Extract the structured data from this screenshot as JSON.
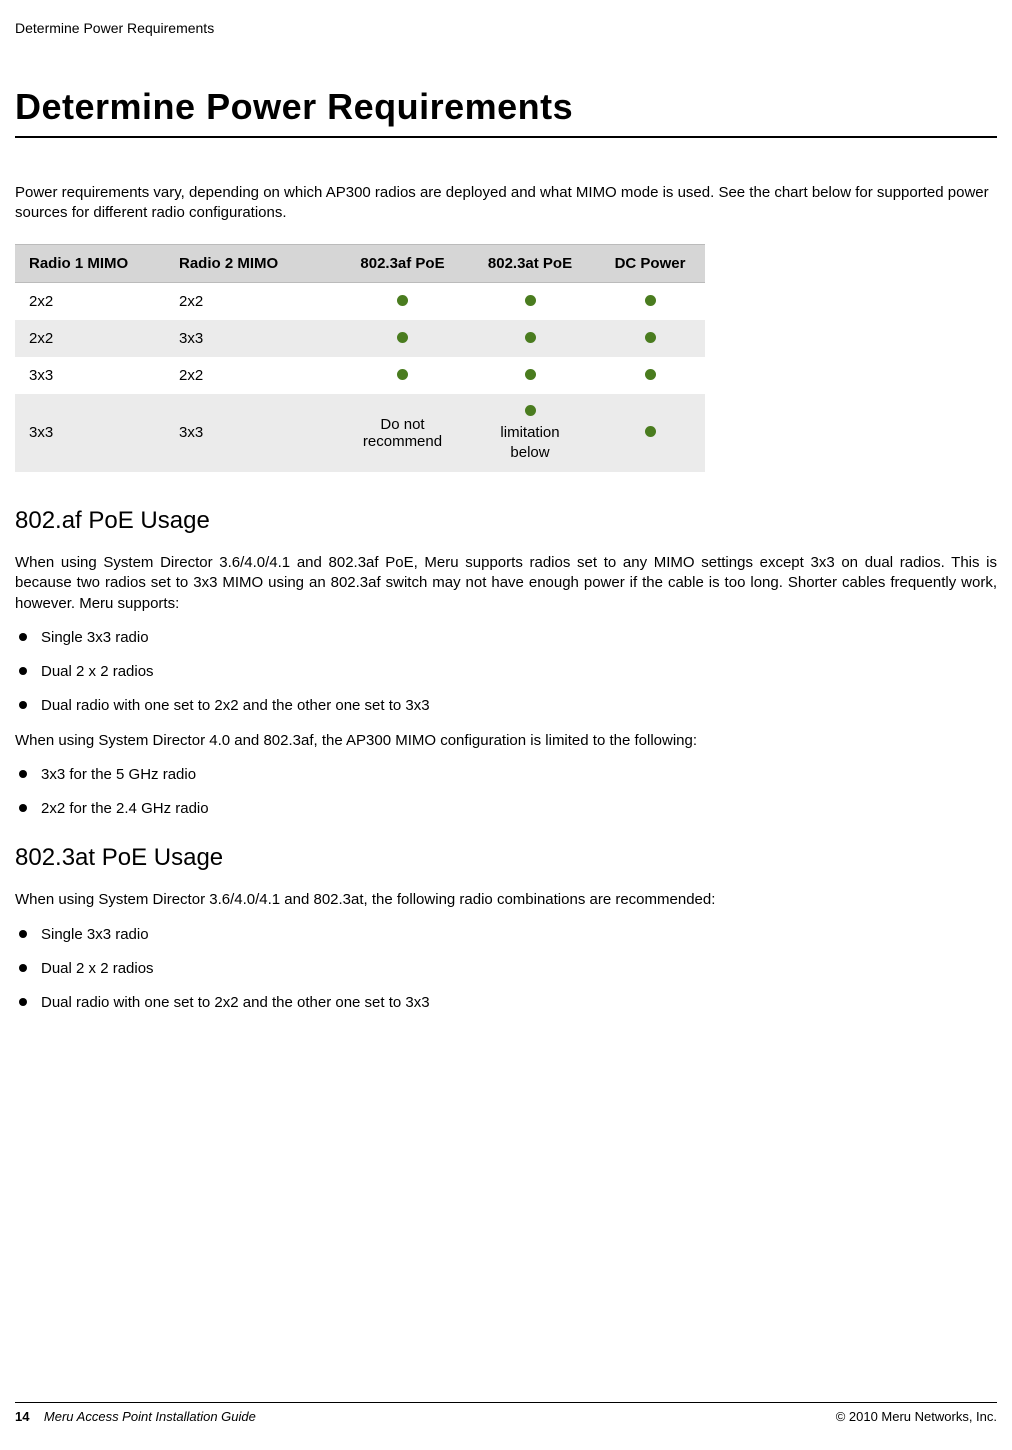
{
  "running_header": "Determine Power Requirements",
  "title": "Determine Power Requirements",
  "intro": "Power requirements vary, depending on which AP300 radios are deployed and what MIMO mode is used. See the chart below for supported power sources for different radio configurations.",
  "table": {
    "headers": [
      "Radio 1 MIMO",
      "Radio 2 MIMO",
      "802.3af PoE",
      "802.3at PoE",
      "DC Power"
    ],
    "rows": [
      {
        "r1": "2x2",
        "r2": "2x2",
        "af": "dot",
        "at": "dot",
        "dc": "dot"
      },
      {
        "r1": "2x2",
        "r2": "3x3",
        "af": "dot",
        "at": "dot",
        "dc": "dot"
      },
      {
        "r1": "3x3",
        "r2": "2x2",
        "af": "dot",
        "at": "dot",
        "dc": "dot"
      },
      {
        "r1": "3x3",
        "r2": "3x3",
        "af": "Do not recommend",
        "at": "limitation below",
        "dc": "dot"
      }
    ]
  },
  "section_af": {
    "heading": "802.af PoE Usage",
    "para1": "When using System Director 3.6/4.0/4.1 and 802.3af PoE, Meru supports radios set to any MIMO settings except 3x3 on dual radios. This is because two radios set to 3x3 MIMO using an 802.3af switch may not have enough power if the cable is too long. Shorter cables frequently work, however. Meru supports:",
    "list1": [
      "Single 3x3 radio",
      "Dual 2 x 2 radios",
      "Dual radio with one set to 2x2 and the other one set to 3x3"
    ],
    "para2": "When using System Director 4.0 and 802.3af, the AP300 MIMO configuration is limited to the following:",
    "list2": [
      "3x3 for the 5 GHz radio",
      "2x2 for the 2.4 GHz radio"
    ]
  },
  "section_at": {
    "heading": "802.3at PoE Usage",
    "para1": "When using System Director 3.6/4.0/4.1 and 802.3at, the following radio combinations are recommended:",
    "list1": [
      "Single 3x3 radio",
      "Dual 2 x 2 radios",
      "Dual radio with one set to 2x2 and the other one set to 3x3"
    ]
  },
  "footer": {
    "page_number": "14",
    "doc_title": "Meru Access Point Installation Guide",
    "copyright": "© 2010 Meru Networks, Inc."
  }
}
